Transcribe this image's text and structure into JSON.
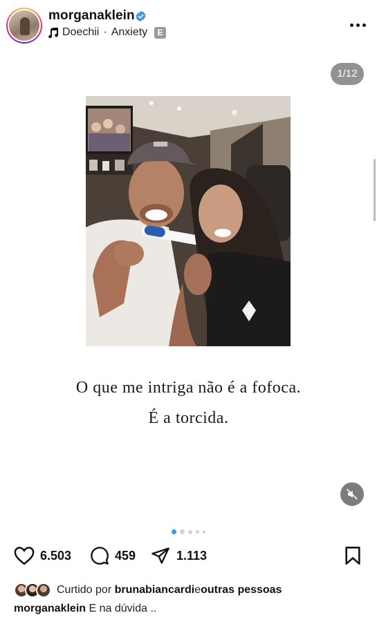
{
  "header": {
    "username": "morganaklein",
    "verified_icon": "verified-badge-icon",
    "artist": "Doechii",
    "separator": " · ",
    "song": "Anxiety",
    "explicit_label": "E",
    "more_icon": "more-horizontal-icon"
  },
  "post": {
    "counter": "1/12",
    "caption_line1": "O que me intriga não é a fofoca.",
    "caption_line2": "É a torcida.",
    "mute_icon": "speaker-muted-icon",
    "page_indicator": {
      "current": 1,
      "visible_dots": 5
    }
  },
  "actions": {
    "likes": "6.503",
    "comments": "459",
    "shares": "1.113"
  },
  "liked_by": {
    "prefix": "Curtido por",
    "user": "brunabiancardi",
    "connector": " e ",
    "others": "outras pessoas"
  },
  "caption": {
    "username": "morganaklein",
    "text": "E na dúvida .."
  },
  "colors": {
    "verified": "#3897f0",
    "text": "#111111",
    "muted_text": "#222222",
    "dot_active": "#3897f0"
  }
}
